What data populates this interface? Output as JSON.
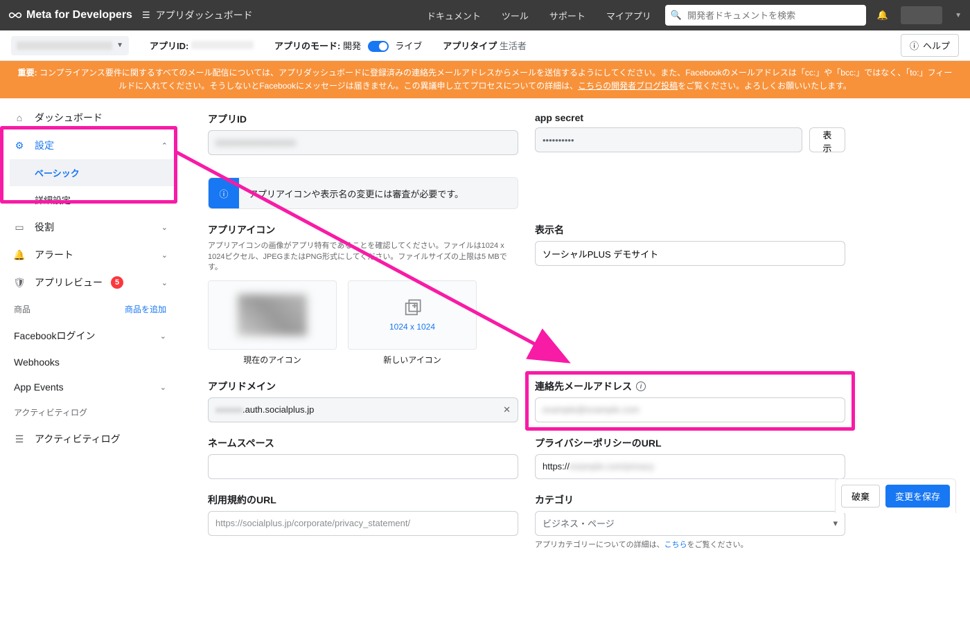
{
  "header": {
    "brand": "Meta for Developers",
    "breadcrumb": "アプリダッシュボード",
    "nav": {
      "docs": "ドキュメント",
      "tools": "ツール",
      "support": "サポート",
      "myapps": "マイアプリ"
    },
    "search_placeholder": "開発者ドキュメントを検索"
  },
  "subheader": {
    "app_id_label": "アプリID:",
    "mode_label": "アプリのモード:",
    "mode_dev": "開発",
    "mode_live": "ライブ",
    "app_type_label": "アプリタイプ",
    "app_type_val": "生活者",
    "help": "ヘルプ"
  },
  "banner": {
    "prefix": "重要:",
    "text1": " コンプライアンス要件に関するすべてのメール配信については、アプリダッシュボードに登録済みの連絡先メールアドレスからメールを送信するようにしてください。また、Facebookのメールアドレスは「cc:」や「bcc:」ではなく、「to:」フィールドに入れてください。そうしないとFacebookにメッセージは届きません。この異議申し立てプロセスについての詳細は、",
    "link": "こちらの開発者ブログ投稿",
    "text2": "をご覧ください。よろしくお願いいたします。"
  },
  "sidebar": {
    "dashboard": "ダッシュボード",
    "settings": "設定",
    "basic": "ベーシック",
    "advanced": "詳細設定",
    "roles": "役割",
    "alerts": "アラート",
    "review": "アプリレビュー",
    "review_count": "5",
    "products_label": "商品",
    "add_product": "商品を追加",
    "fb_login": "Facebookログイン",
    "webhooks": "Webhooks",
    "app_events": "App Events",
    "activity_section": "アクティビティログ",
    "activity_log": "アクティビティログ"
  },
  "form": {
    "app_id_label": "アプリID",
    "app_secret_label": "app secret",
    "app_secret_val": "••••••••••",
    "show": "表示",
    "info_banner": "アプリアイコンや表示名の変更には審査が必要です。",
    "icon_section_label": "アプリアイコン",
    "icon_help": "アプリアイコンの画像がアプリ特有であることを確認してください。ファイルは1024 x 1024ピクセル、JPEGまたはPNG形式にしてください。ファイルサイズの上限は5 MBです。",
    "icon_size_hint": "1024 x 1024",
    "current_icon": "現在のアイコン",
    "new_icon": "新しいアイコン",
    "display_name_label": "表示名",
    "display_name_val": "ソーシャルPLUS デモサイト",
    "app_domain_label": "アプリドメイン",
    "app_domain_val": ".auth.socialplus.jp",
    "contact_email_label": "連絡先メールアドレス",
    "namespace_label": "ネームスペース",
    "privacy_url_label": "プライバシーポリシーのURL",
    "privacy_url_val": "https://",
    "tos_url_label": "利用規約のURL",
    "tos_url_placeholder": "https://socialplus.jp/corporate/privacy_statement/",
    "category_label": "カテゴリ",
    "category_val": "ビジネス・ページ",
    "category_help_pre": "アプリカテゴリーについての詳細は、",
    "category_help_link": "こちら",
    "category_help_post": "をご覧ください。"
  },
  "footer": {
    "discard": "破棄",
    "save": "変更を保存"
  }
}
